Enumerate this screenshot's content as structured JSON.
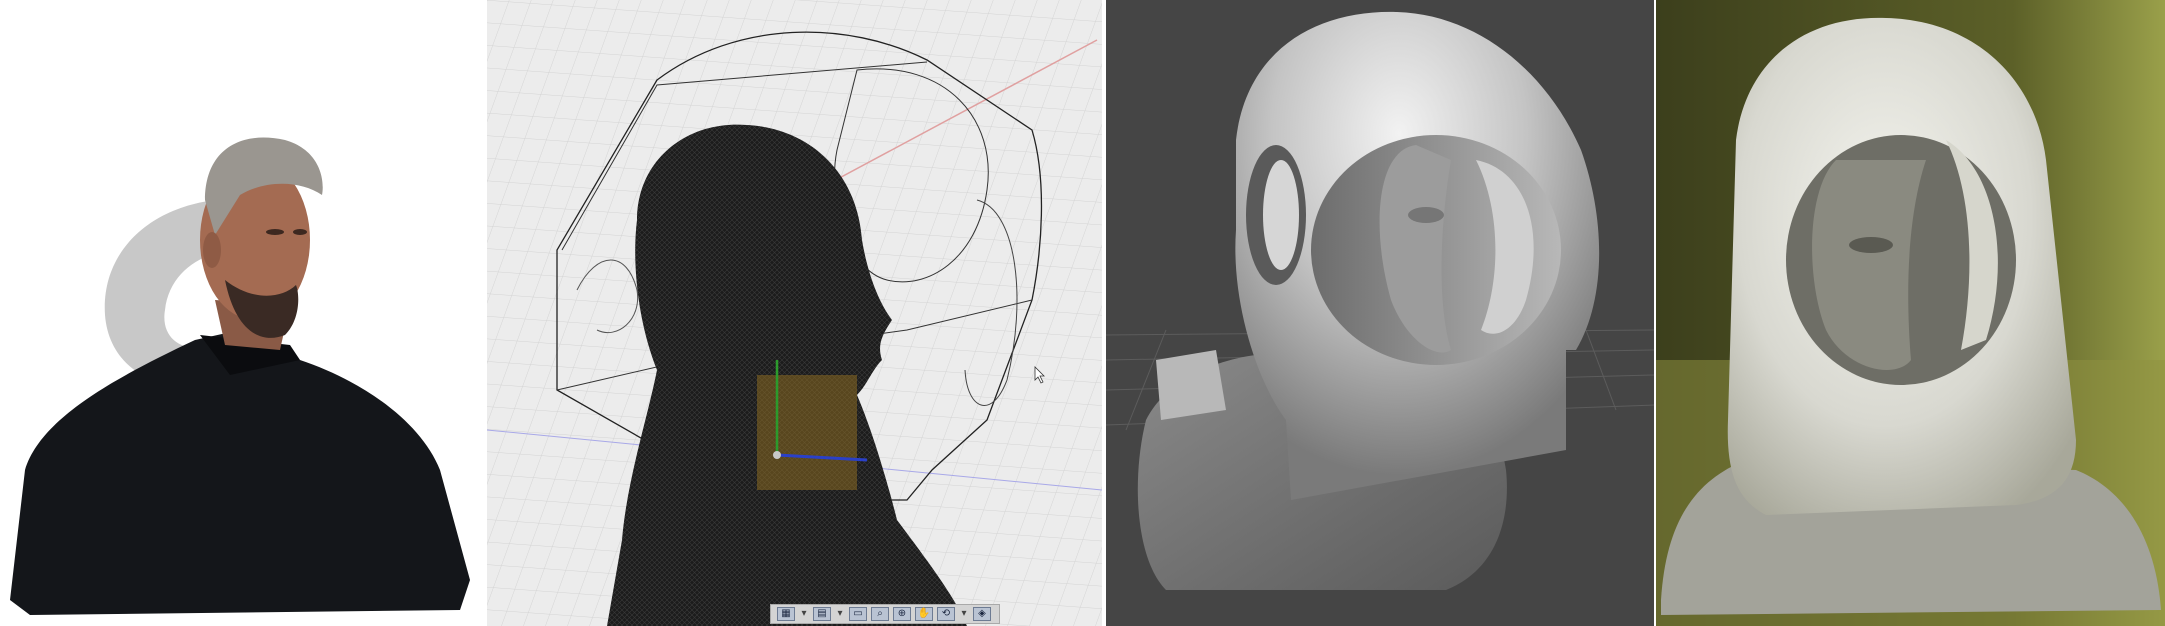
{
  "panels": [
    {
      "id": "photo",
      "description_name": "rgbd-scan-photo"
    },
    {
      "id": "wireframe",
      "description_name": "cad-wireframe-view"
    },
    {
      "id": "render",
      "description_name": "shaded-mesh-render"
    },
    {
      "id": "print",
      "description_name": "3d-printed-object"
    }
  ],
  "viewer_toolbar": {
    "icons": [
      "grid-icon",
      "chevron-down-icon",
      "layers-icon",
      "chevron-down-icon",
      "monitor-icon",
      "zoom-icon",
      "zoom-window-icon",
      "pan-icon",
      "orbit-icon",
      "chevron-down-icon",
      "view-cube-icon"
    ]
  },
  "colors": {
    "render_background": "#454545",
    "cad_background": "#ececec",
    "print_background": "#4a4c24",
    "print_material": "#d8d8d0"
  }
}
